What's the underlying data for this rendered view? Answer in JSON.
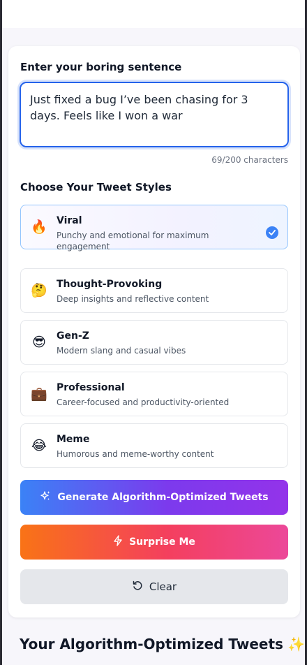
{
  "input": {
    "label": "Enter your boring sentence",
    "value": "Just fixed a bug I’ve been chasing for 3 days. Feels like I won a war",
    "char_count": "69/200 characters"
  },
  "styles": {
    "label": "Choose Your Tweet Styles",
    "items": [
      {
        "title": "Viral",
        "desc": "Punchy and emotional for maximum engagement",
        "emoji": "🔥",
        "selected": true
      },
      {
        "title": "Thought-Provoking",
        "desc": "Deep insights and reflective content",
        "emoji": "🤔",
        "selected": false
      },
      {
        "title": "Gen-Z",
        "desc": "Modern slang and casual vibes",
        "emoji": "😎",
        "selected": false
      },
      {
        "title": "Professional",
        "desc": "Career-focused and productivity-oriented",
        "emoji": "💼",
        "selected": false
      },
      {
        "title": "Meme",
        "desc": "Humorous and meme-worthy content",
        "emoji": "😂",
        "selected": false
      }
    ]
  },
  "buttons": {
    "generate": "Generate Algorithm-Optimized Tweets",
    "surprise": "Surprise Me",
    "clear": "Clear"
  },
  "results": {
    "heading": "Your Algorithm-Optimized Tweets",
    "heading_emoji": "✨"
  },
  "colors": {
    "accent": "#2563eb",
    "check": "#3b82f6",
    "generate_start": "#3b82f6",
    "generate_end": "#9333ea",
    "surprise_start": "#f97316",
    "surprise_end": "#ec4899"
  }
}
